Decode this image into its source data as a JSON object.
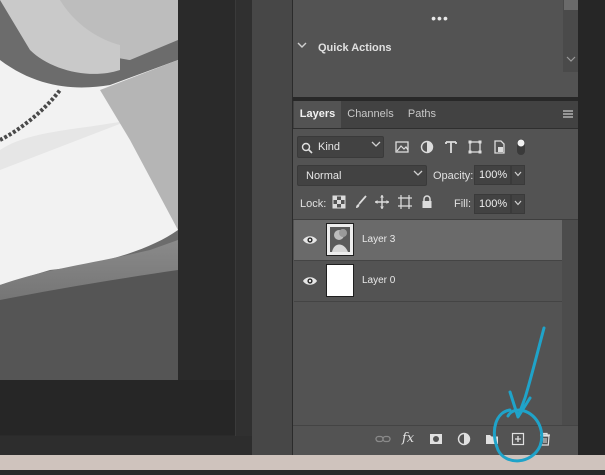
{
  "actions_panel": {
    "more_label": "•••",
    "quick_actions_label": "Quick Actions"
  },
  "tabs": [
    {
      "label": "Layers",
      "active": true
    },
    {
      "label": "Channels",
      "active": false
    },
    {
      "label": "Paths",
      "active": false
    }
  ],
  "filter": {
    "kind_label": "Kind",
    "icons": [
      "image-filter-icon",
      "adjustment-filter-icon",
      "type-filter-icon",
      "shape-filter-icon",
      "smart-object-filter-icon",
      "filter-toggle-icon"
    ]
  },
  "blend": {
    "mode": "Normal",
    "opacity_label": "Opacity:",
    "opacity_value": "100%"
  },
  "lock": {
    "label": "Lock:",
    "icons": [
      "lock-transparent-pixels-icon",
      "lock-image-pixels-icon",
      "lock-position-icon",
      "lock-artboard-icon",
      "lock-all-icon"
    ],
    "fill_label": "Fill:",
    "fill_value": "100%"
  },
  "layers": [
    {
      "name": "Layer 3",
      "visible": true,
      "selected": true
    },
    {
      "name": "Layer 0",
      "visible": true,
      "selected": false
    }
  ],
  "bottom_bar": {
    "icons": [
      "link-layers-icon",
      "fx-icon",
      "add-mask-icon",
      "adjustment-layer-icon",
      "new-group-icon",
      "new-layer-icon",
      "delete-layer-icon"
    ],
    "fx_label": "fx"
  },
  "colors": {
    "panel": "#535353",
    "selected_row": "#6a6a6a",
    "annotation": "#1fa3c9"
  }
}
